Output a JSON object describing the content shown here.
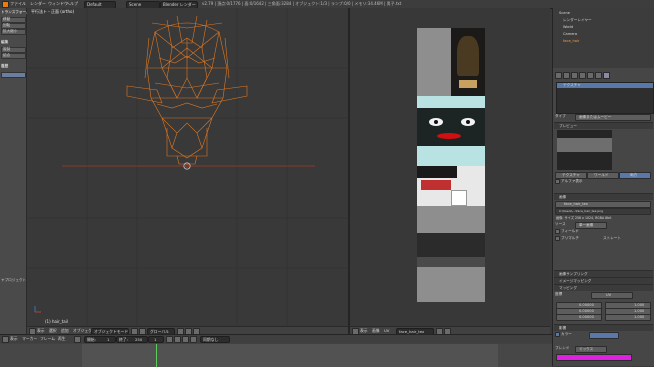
{
  "topbar": {
    "menus": [
      "ファイル",
      "レンダー",
      "ウィンドウ",
      "ヘルプ"
    ],
    "layout": "Default",
    "scene": "Scene",
    "engine": "Blender レンダー",
    "info": "v2.79 | 頂点:0/1776 | 面:0/1642 | 三角面:3284 | オブジェクト:1/3 | ランプ:0/0 | メモリ:34.46M | 男子.txt"
  },
  "left_panel": {
    "tabs": [
      "トランスフォーム",
      "編集",
      "作成",
      "関係",
      "アニメーション",
      "物理演算",
      "グリースペンシル"
    ],
    "section_title": "トランスフォーム",
    "buttons": [
      "移動",
      "回転",
      "拡大縮小"
    ],
    "section2": "編集",
    "buttons2": [
      "複製",
      "結合"
    ],
    "history": "履歴",
    "footer": "ヤプロジェクト"
  },
  "viewport3d": {
    "header": "平行法ト・正面 (ortho)",
    "object_label": "(1) hair_tail",
    "footer": [
      "表示",
      "選択",
      "追加",
      "オブジェクト",
      "オブジェクトモード",
      "グローバル"
    ]
  },
  "image_editor": {
    "footer": [
      "表示",
      "画像",
      "UV",
      "face_hair_tex"
    ]
  },
  "right_panel": {
    "outliner": [
      "Scene",
      "レンダーレイヤー",
      "World",
      "Camera",
      "face_hair"
    ],
    "tabs_label": "テクスチャ",
    "slot_active": "テクスチャ",
    "type_label": "タイプ",
    "type_value": "画像またはムービー",
    "preview_label": "プレビュー",
    "preview_tabs": [
      "テクスチャ",
      "ワールド",
      "両方"
    ],
    "alpha_label": "アルファ表示",
    "image_label": "画像",
    "image_name": "face_hair_tex",
    "path": "C:\\Users\\...\\face_hair_tex.png",
    "source_label": "ソース",
    "source_value": "単一画像",
    "resolution": "画像: サイズ 256 x 1024, RGBA 8bit",
    "fields_label": "フィールド",
    "premult": "プリマルチ",
    "straight": "ストレート",
    "mapping": "画像サンプリング",
    "image_mapping": "イメージマッピング",
    "map_mapping": "マッピング",
    "coord_label": "座標",
    "coord_value": "UV",
    "offset": [
      "0.00000",
      "0.00000",
      "0.00000"
    ],
    "size": [
      "1.000",
      "1.000",
      "1.000"
    ],
    "influence": "影響",
    "color_label": "カラー",
    "blend_label": "ブレンド",
    "blend_value": "ミックス",
    "accent": "#e020e0"
  },
  "timeline": {
    "footer": [
      "表示",
      "マーカー",
      "フレーム",
      "再生"
    ],
    "start_label": "開始:",
    "start": "1",
    "end_label": "終了:",
    "end": "250",
    "current": "1",
    "no_sync": "同期なし"
  }
}
